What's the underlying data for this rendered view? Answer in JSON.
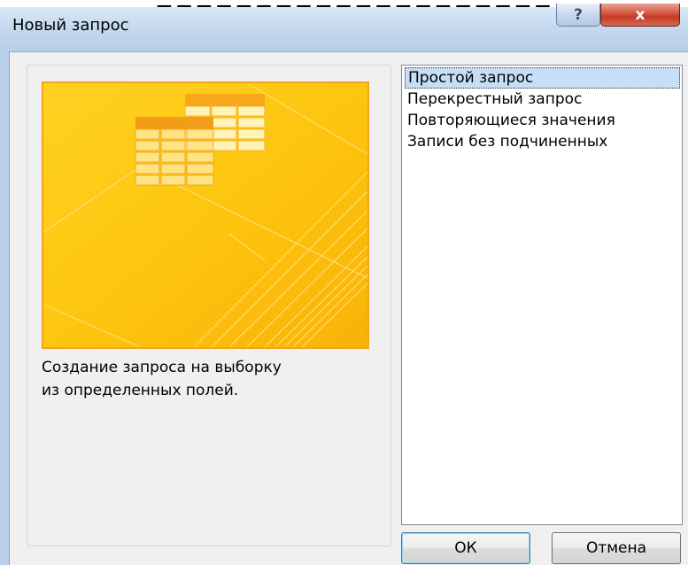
{
  "dialog": {
    "title": "Новый запрос",
    "help_label": "?",
    "close_label": "x"
  },
  "left_panel": {
    "description_line1": "Создание запроса на выборку",
    "description_line2": "из определенных полей."
  },
  "query_types": [
    "Простой запрос",
    "Перекрестный запрос",
    "Повторяющиеся значения",
    "Записи без подчиненных"
  ],
  "selected_index": 0,
  "buttons": {
    "ok": "ОК",
    "cancel": "Отмена"
  },
  "colors": {
    "preview_background": "#fdc70f",
    "preview_border": "#f6a319",
    "selection": "#c6def6",
    "close_button": "#c23a26"
  },
  "icons": {
    "preview": "table-grid-illustration"
  }
}
